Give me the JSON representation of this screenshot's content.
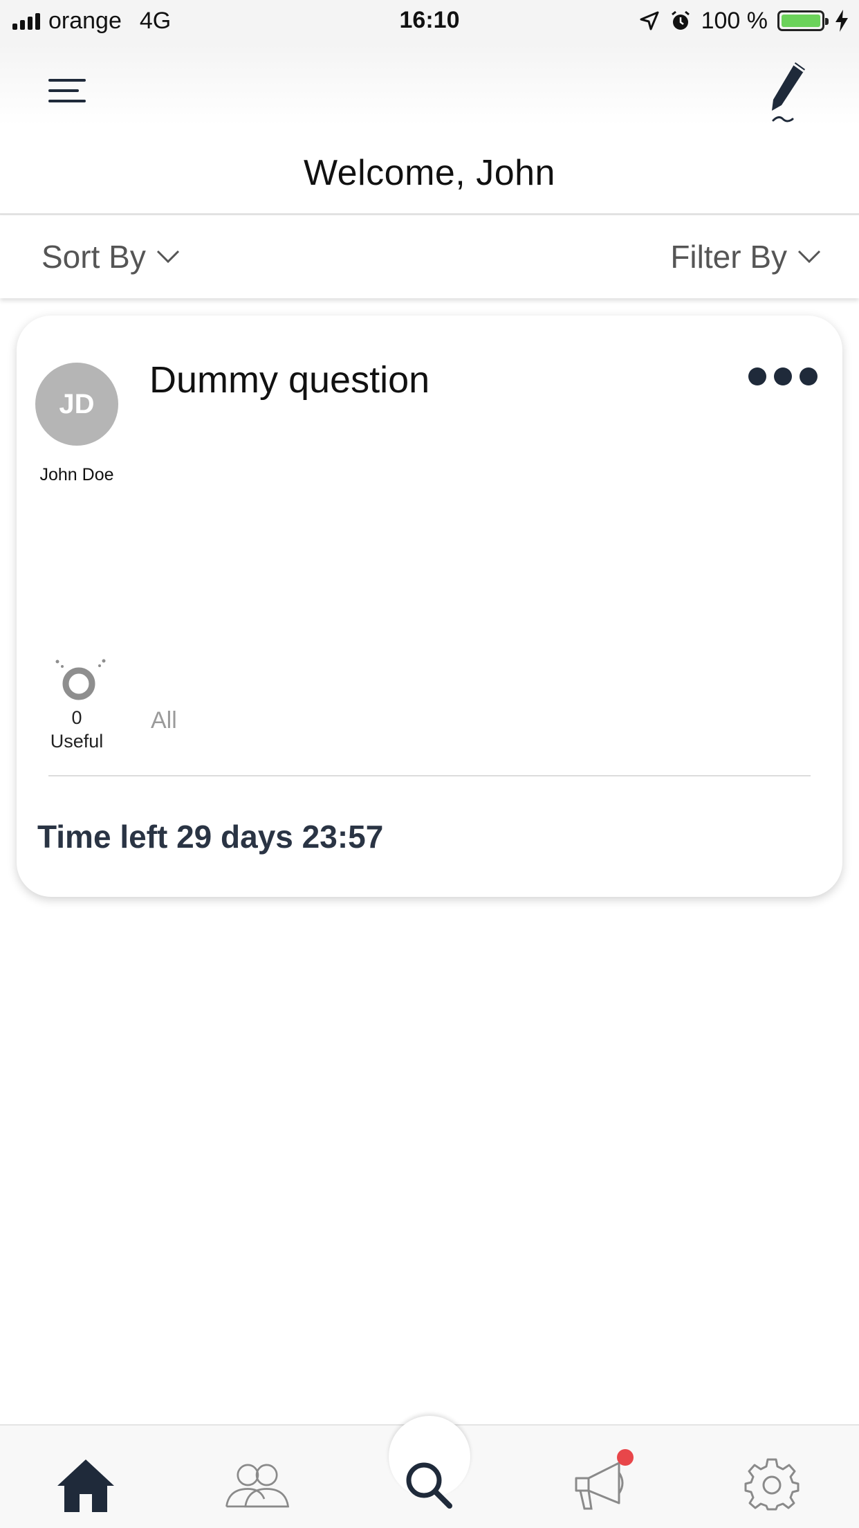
{
  "status_bar": {
    "carrier": "orange",
    "network": "4G",
    "time": "16:10",
    "battery_percent": "100 %",
    "battery_color": "#6bd25a"
  },
  "header": {
    "menu_icon": "hamburger-menu-icon",
    "compose_icon": "pencil-icon",
    "welcome_text": "Welcome, John"
  },
  "toolbar": {
    "sort_label": "Sort By",
    "filter_label": "Filter By"
  },
  "question_card": {
    "avatar_initials": "JD",
    "author_name": "John Doe",
    "title": "Dummy question",
    "useful_count": "0",
    "useful_label": "Useful",
    "all_link": "All",
    "time_left": "Time left 29 days 23:57"
  },
  "tabbar": {
    "items": [
      {
        "name": "home",
        "icon": "home-icon",
        "active": true
      },
      {
        "name": "people",
        "icon": "people-icon",
        "active": false
      },
      {
        "name": "search",
        "icon": "search-icon",
        "active": false
      },
      {
        "name": "announcements",
        "icon": "megaphone-icon",
        "active": false,
        "has_badge": true
      },
      {
        "name": "settings",
        "icon": "gear-icon",
        "active": false
      }
    ],
    "active_color": "#1f2a3a",
    "inactive_color": "#8a8a8a",
    "badge_color": "#e8464a"
  }
}
